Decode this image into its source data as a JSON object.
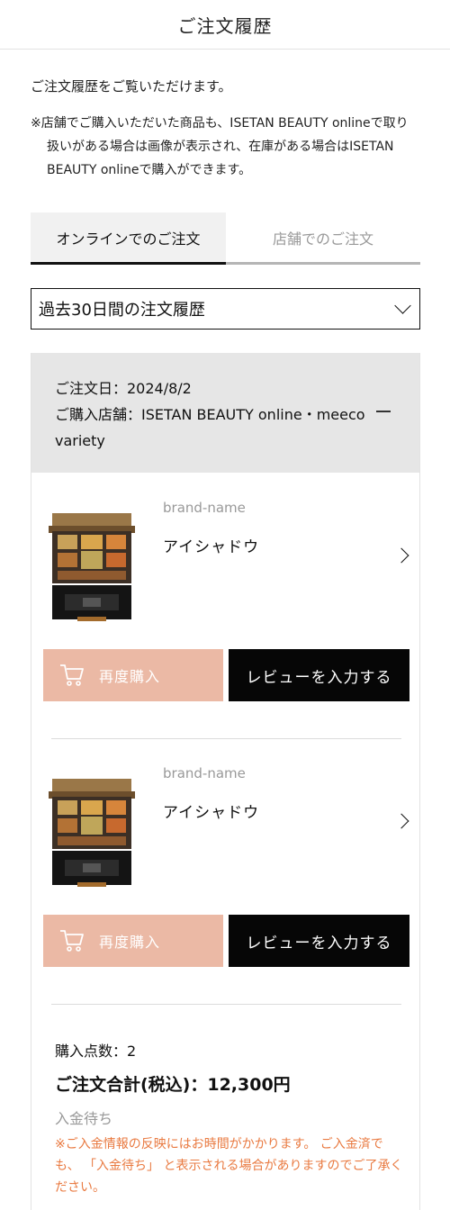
{
  "header": {
    "title": "ご注文履歴"
  },
  "intro": {
    "text": "ご注文履歴をご覧いただけます。",
    "note": "※店舗でご購入いただいた商品も、ISETAN BEAUTY onlineで取り扱いがある場合は画像が表示され、在庫がある場合はISETAN BEAUTY onlineで購入ができます。"
  },
  "tabs": [
    {
      "label": "オンラインでのご注文",
      "active": true
    },
    {
      "label": "店舗でのご注文",
      "active": false
    }
  ],
  "period": {
    "selected": "過去30日間の注文履歴"
  },
  "order": {
    "date_line": "ご注文日：2024/8/2",
    "shop_line": "ご購入店舗：ISETAN BEAUTY online・meeco variety",
    "items": [
      {
        "brand": "brand-name",
        "name": "アイシャドウ",
        "rebuy_label": "再度購入",
        "review_label": "レビューを入力する"
      },
      {
        "brand": "brand-name",
        "name": "アイシャドウ",
        "rebuy_label": "再度購入",
        "review_label": "レビューを入力する"
      }
    ],
    "summary": {
      "count": "購入点数：2",
      "total": "ご注文合計(税込)：12,300円",
      "status": "入金待ち",
      "notice": "※ご入金情報の反映にはお時間がかかります。 ご入金済でも、 「入金待ち」 と表示される場合がありますのでご了承ください。"
    }
  },
  "colors": {
    "rebuy_button": "#ebb9a5",
    "review_button": "#060606",
    "notice": "#e97a41"
  },
  "icons": [
    "cart-icon",
    "chevron-down-icon",
    "chevron-right-icon",
    "collapse-icon"
  ]
}
